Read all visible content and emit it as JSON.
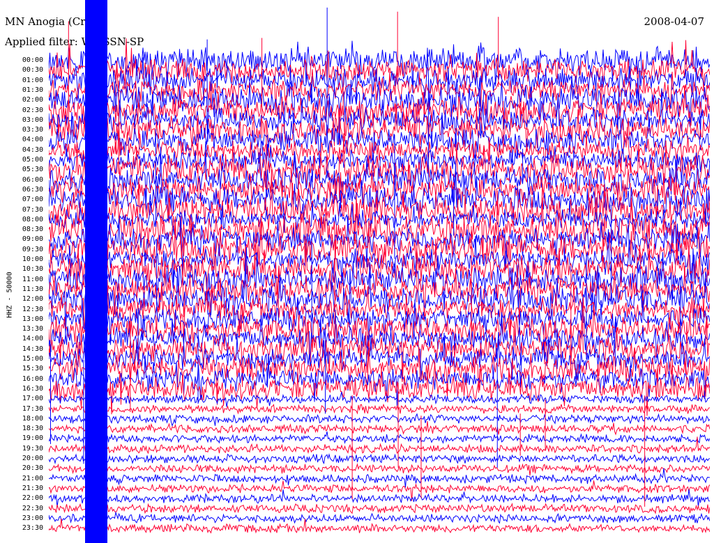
{
  "header": {
    "station": "MN Anogia (Crete)",
    "date": "2008-04-07",
    "filter": "Applied filter: WWSSN-SP"
  },
  "chart_data": {
    "type": "line",
    "title": "MN Anogia (Crete)",
    "ylabel": "HHZ - 50000",
    "y_ticks": [
      "00:00",
      "00:30",
      "01:00",
      "01:30",
      "02:00",
      "02:30",
      "03:00",
      "03:30",
      "04:00",
      "04:30",
      "05:00",
      "05:30",
      "06:00",
      "06:30",
      "07:00",
      "07:30",
      "08:00",
      "08:30",
      "09:00",
      "09:30",
      "10:00",
      "10:30",
      "11:00",
      "11:30",
      "12:00",
      "12:30",
      "13:00",
      "13:30",
      "14:00",
      "14:30",
      "15:00",
      "15:30",
      "16:00",
      "16:30",
      "17:00",
      "17:30",
      "18:00",
      "18:30",
      "19:00",
      "19:30",
      "20:00",
      "20:30",
      "21:00",
      "21:30",
      "22:00",
      "22:30",
      "23:00",
      "23:30"
    ],
    "trace_colors": [
      "#0000ff",
      "#ff0033"
    ],
    "grid": false
  }
}
